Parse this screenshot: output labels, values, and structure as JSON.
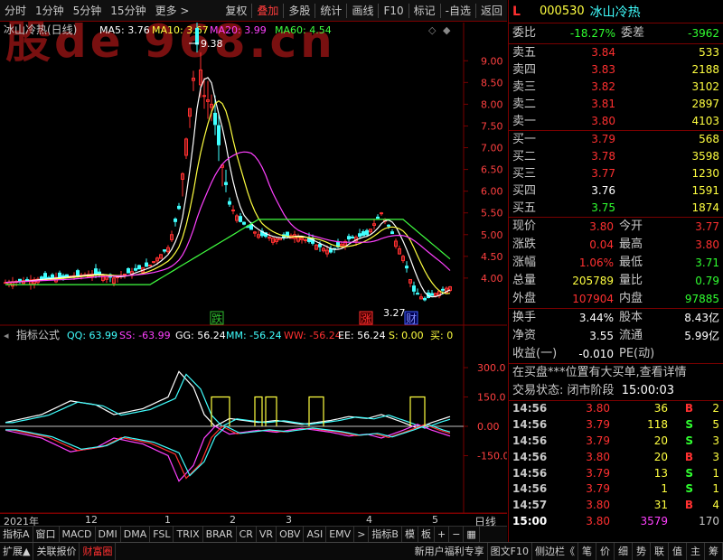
{
  "toolbar": {
    "left": [
      "分时",
      "1分钟",
      "5分钟",
      "15分钟",
      "更多 >"
    ],
    "right": [
      "复权",
      "叠加",
      "多股",
      "统计",
      "画线",
      "F10",
      "标记",
      "-自选",
      "返回"
    ],
    "active": "叠加"
  },
  "watermark": "股de 968.cn",
  "kline": {
    "title": "冰山冷热(日线)",
    "ma": [
      {
        "label": "MA5: 3.76",
        "color": "#ffffff"
      },
      {
        "label": "MA10: 3.67",
        "color": "#ffff40"
      },
      {
        "label": "MA20: 3.99",
        "color": "#ff40ff"
      },
      {
        "label": "MA60: 4.54",
        "color": "#40ff40"
      }
    ],
    "high_label": "9.38",
    "low_label": "3.27",
    "y_ticks": [
      "9.00",
      "8.50",
      "8.00",
      "7.50",
      "7.00",
      "6.50",
      "6.00",
      "5.50",
      "5.00",
      "4.50",
      "4.00"
    ],
    "y_min": 3.2,
    "y_max": 9.4,
    "markers": [
      {
        "text": "跌",
        "color": "#30c030"
      },
      {
        "text": "涨",
        "color": "#ff3030"
      },
      {
        "text": "财",
        "color": "#4060ff"
      }
    ]
  },
  "indicator": {
    "title": "指标公式",
    "params": [
      {
        "label": "QQ: 63.99",
        "color": "#40ffff"
      },
      {
        "label": "SS: -63.99",
        "color": "#ff40ff"
      },
      {
        "label": "GG: 56.24",
        "color": "#ffffff"
      },
      {
        "label": "MM: -56.24",
        "color": "#40ffff"
      },
      {
        "label": "WW: -56.24",
        "color": "#ff3030"
      },
      {
        "label": "EE: 56.24",
        "color": "#ffffff"
      },
      {
        "label": "S: 0.00",
        "color": "#ffff40"
      },
      {
        "label": "买: 0",
        "color": "#ffff40"
      }
    ],
    "y_ticks": [
      "300.0",
      "150.0",
      "0.00",
      "-150.0"
    ]
  },
  "date_axis": {
    "labels": [
      "2021年",
      "12",
      "1",
      "2",
      "3",
      "4",
      "5"
    ],
    "right": "日线"
  },
  "bottom_tabs": [
    "指标A",
    "窗口",
    "MACD",
    "DMI",
    "DMA",
    "FSL",
    "TRIX",
    "BRAR",
    "CR",
    "VR",
    "OBV",
    "ASI",
    "EMV",
    ">",
    "指标B",
    "模",
    "板",
    "+",
    "−",
    "▦"
  ],
  "status_left": [
    "扩展▲",
    "关联报价",
    "财富圈"
  ],
  "status_mid": [
    "新用户福利专享",
    "图文F10",
    "侧边栏《"
  ],
  "status_right": [
    "笔",
    "价",
    "细",
    "势",
    "联",
    "值",
    "主",
    "筹"
  ],
  "quote": {
    "marker": "L",
    "code": "000530",
    "name": "冰山冷热",
    "weibi_label": "委比",
    "weibi": "-18.27%",
    "weicha_label": "委差",
    "weicha": "-3962",
    "sells": [
      {
        "label": "卖五",
        "price": "3.84",
        "vol": "533"
      },
      {
        "label": "卖四",
        "price": "3.83",
        "vol": "2188"
      },
      {
        "label": "卖三",
        "price": "3.82",
        "vol": "3102"
      },
      {
        "label": "卖二",
        "price": "3.81",
        "vol": "2897"
      },
      {
        "label": "卖一",
        "price": "3.80",
        "vol": "4103"
      }
    ],
    "buys": [
      {
        "label": "买一",
        "price": "3.79",
        "vol": "568",
        "c": "red"
      },
      {
        "label": "买二",
        "price": "3.78",
        "vol": "3598",
        "c": "red"
      },
      {
        "label": "买三",
        "price": "3.77",
        "vol": "1230",
        "c": "red"
      },
      {
        "label": "买四",
        "price": "3.76",
        "vol": "1591",
        "c": "white"
      },
      {
        "label": "买五",
        "price": "3.75",
        "vol": "1874",
        "c": "green"
      }
    ],
    "stats": [
      {
        "a": "现价",
        "b": "3.80",
        "bc": "red",
        "c": "今开",
        "d": "3.77",
        "dc": "red"
      },
      {
        "a": "涨跌",
        "b": "0.04",
        "bc": "red",
        "c": "最高",
        "d": "3.80",
        "dc": "red"
      },
      {
        "a": "涨幅",
        "b": "1.06%",
        "bc": "red",
        "c": "最低",
        "d": "3.71",
        "dc": "green"
      },
      {
        "a": "总量",
        "b": "205789",
        "bc": "yellow",
        "c": "量比",
        "d": "0.79",
        "dc": "green"
      },
      {
        "a": "外盘",
        "b": "107904",
        "bc": "red",
        "c": "内盘",
        "d": "97885",
        "dc": "green"
      }
    ],
    "finance": [
      {
        "a": "换手",
        "b": "3.44%",
        "c": "股本",
        "d": "8.43亿"
      },
      {
        "a": "净资",
        "b": "3.55",
        "c": "流通",
        "d": "5.99亿"
      },
      {
        "a": "收益(一)",
        "b": "-0.010",
        "c": "PE(动)",
        "d": ""
      }
    ],
    "info1": "在买盘***位置有大买单,查看详情",
    "info2_label": "交易状态:",
    "info2_status": "闭市阶段",
    "info2_time": "15:00:03",
    "ticks": [
      {
        "t": "14:56",
        "p": "3.80",
        "pc": "red",
        "v": "36",
        "f": "B",
        "fc": "red",
        "x": "2"
      },
      {
        "t": "14:56",
        "p": "3.79",
        "pc": "red",
        "v": "118",
        "f": "S",
        "fc": "green",
        "x": "5"
      },
      {
        "t": "14:56",
        "p": "3.79",
        "pc": "red",
        "v": "20",
        "f": "S",
        "fc": "green",
        "x": "3"
      },
      {
        "t": "14:56",
        "p": "3.80",
        "pc": "red",
        "v": "20",
        "f": "B",
        "fc": "red",
        "x": "3"
      },
      {
        "t": "14:56",
        "p": "3.79",
        "pc": "red",
        "v": "13",
        "f": "S",
        "fc": "green",
        "x": "1"
      },
      {
        "t": "14:56",
        "p": "3.79",
        "pc": "red",
        "v": "1",
        "f": "S",
        "fc": "green",
        "x": "1"
      },
      {
        "t": "14:57",
        "p": "3.80",
        "pc": "red",
        "v": "31",
        "f": "B",
        "fc": "red",
        "x": "4"
      },
      {
        "t": "15:00",
        "p": "3.80",
        "pc": "red",
        "v": "3579",
        "f": "",
        "fc": "red",
        "x": "170"
      }
    ]
  }
}
